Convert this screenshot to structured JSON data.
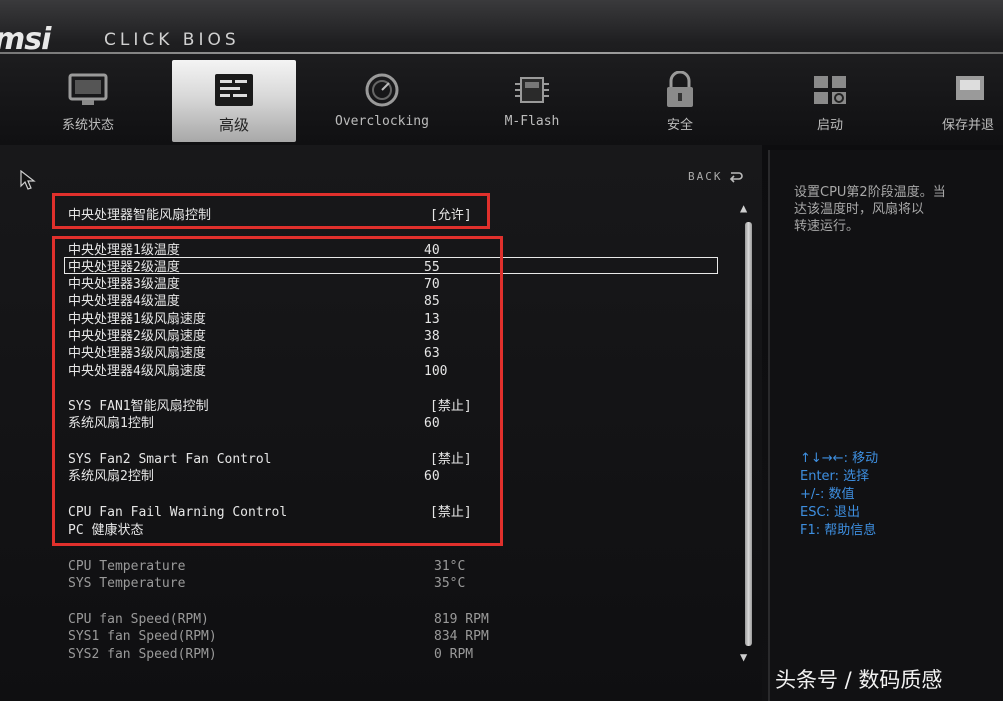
{
  "header": {
    "brand": "msi",
    "product": "CLICK BIOS"
  },
  "tabs": [
    {
      "label": "系统状态",
      "icon": "monitor-icon"
    },
    {
      "label": "高级",
      "icon": "settings-panel-icon"
    },
    {
      "label": "Overclocking",
      "icon": "gauge-icon"
    },
    {
      "label": "M-Flash",
      "icon": "flash-chip-icon"
    },
    {
      "label": "安全",
      "icon": "lock-icon"
    },
    {
      "label": "启动",
      "icon": "boot-icon"
    },
    {
      "label": "保存并退",
      "icon": "save-exit-icon"
    }
  ],
  "main": {
    "back_label": "BACK",
    "rows": [
      {
        "name": "中央处理器智能风扇控制",
        "value": "[允许]"
      },
      {
        "name": "中央处理器1级温度",
        "value": "40"
      },
      {
        "name": "中央处理器2级温度",
        "value": "55"
      },
      {
        "name": "中央处理器3级温度",
        "value": "70"
      },
      {
        "name": "中央处理器4级温度",
        "value": "85"
      },
      {
        "name": "中央处理器1级风扇速度",
        "value": "13"
      },
      {
        "name": "中央处理器2级风扇速度",
        "value": "38"
      },
      {
        "name": "中央处理器3级风扇速度",
        "value": "63"
      },
      {
        "name": "中央处理器4级风扇速度",
        "value": "100"
      },
      {
        "name": "SYS FAN1智能风扇控制",
        "value": "[禁止]"
      },
      {
        "name": "系统风扇1控制",
        "value": "60"
      },
      {
        "name": "SYS Fan2 Smart Fan Control",
        "value": "[禁止]"
      },
      {
        "name": "系统风扇2控制",
        "value": "60"
      },
      {
        "name": "CPU Fan Fail Warning Control",
        "value": "[禁止]"
      }
    ],
    "pc_health_header": "PC 健康状态",
    "health": [
      {
        "name": "CPU Temperature",
        "value": "31°C"
      },
      {
        "name": "SYS Temperature",
        "value": "35°C"
      },
      {
        "name": "CPU fan Speed(RPM)",
        "value": "819 RPM"
      },
      {
        "name": "SYS1 fan Speed(RPM)",
        "value": "834 RPM"
      },
      {
        "name": "SYS2 fan Speed(RPM)",
        "value": "0 RPM"
      }
    ]
  },
  "help": {
    "text_lines": [
      "设置CPU第2阶段温度。当",
      "达该温度时，风扇将以",
      "转速运行。"
    ],
    "keys": [
      "↑↓→←: 移动",
      "Enter: 选择",
      "+/-: 数值",
      "ESC: 退出",
      "F1: 帮助信息"
    ]
  },
  "watermark": "头条号 / 数码质感",
  "colors": {
    "highlight_box": "#e0302c",
    "key_help": "#3e8fe0",
    "active_tab": "#e6e6e6"
  }
}
